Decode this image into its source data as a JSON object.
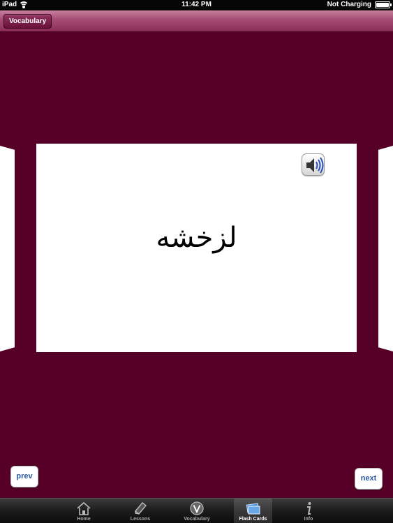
{
  "status_bar": {
    "device": "iPad",
    "time": "11:42 PM",
    "charging": "Not Charging"
  },
  "nav_bar": {
    "back_label": "Vocabulary"
  },
  "card": {
    "word": "لزخشه",
    "audio_icon": "speaker-icon"
  },
  "pager": {
    "prev_label": "prev",
    "next_label": "next"
  },
  "tab_bar": {
    "tabs": [
      {
        "label": "Home",
        "icon": "house-icon",
        "active": false
      },
      {
        "label": "Lessons",
        "icon": "book-icon",
        "active": false
      },
      {
        "label": "Vocabulary",
        "icon": "v-logo-icon",
        "active": false
      },
      {
        "label": "Flash Cards",
        "icon": "flash-cards-icon",
        "active": true
      },
      {
        "label": "Info",
        "icon": "info-icon",
        "active": false
      }
    ]
  },
  "colors": {
    "background": "#560027",
    "nav_bar": "#a84f75",
    "button_text": "#2c5aa0"
  }
}
